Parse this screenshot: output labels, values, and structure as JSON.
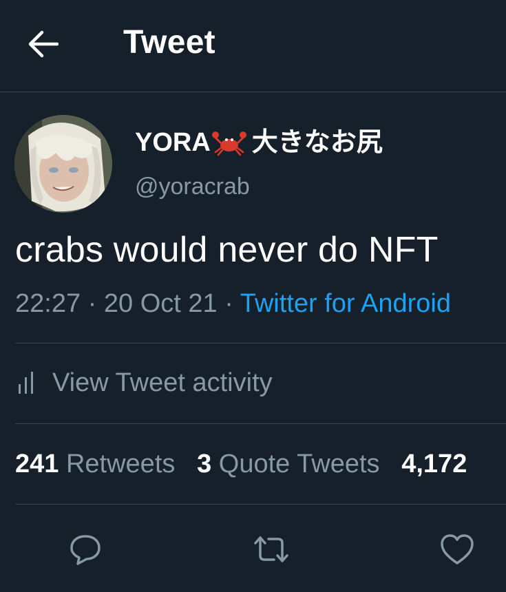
{
  "header": {
    "title": "Tweet",
    "back_icon": "arrow-left-icon"
  },
  "author": {
    "name": "YORA",
    "name_emoji": "crab-icon",
    "name_suffix": "大きなお尻",
    "handle": "@yoracrab"
  },
  "tweet": {
    "text": "crabs would never do NFT",
    "time": "22:27",
    "separator": " · ",
    "date": "20 Oct 21",
    "source": "Twitter for Android"
  },
  "activity": {
    "label": "View Tweet activity",
    "icon": "bar-chart-icon"
  },
  "stats": {
    "retweets_count": "241",
    "retweets_label": "Retweets",
    "quotes_count": "3",
    "quotes_label": "Quote Tweets",
    "likes_count": "4,172"
  },
  "actions": [
    "reply-icon",
    "retweet-icon",
    "like-icon"
  ],
  "colors": {
    "background": "#15202b",
    "divider": "#38444d",
    "secondary_text": "#8899a6",
    "link": "#1da1f2",
    "primary_text": "#ffffff"
  }
}
